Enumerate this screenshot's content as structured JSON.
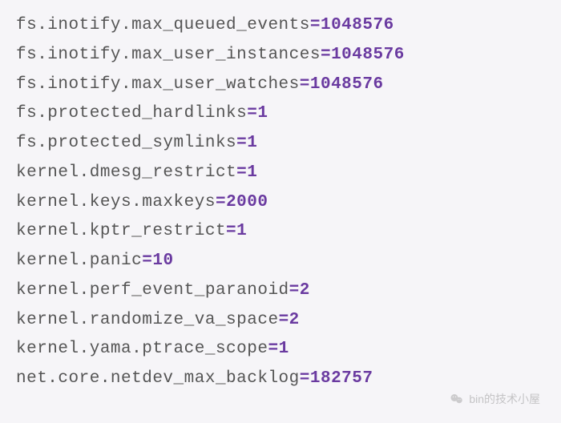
{
  "settings": [
    {
      "key": "fs.inotify.max_queued_events",
      "value": "1048576"
    },
    {
      "key": "fs.inotify.max_user_instances",
      "value": "1048576"
    },
    {
      "key": "fs.inotify.max_user_watches",
      "value": "1048576"
    },
    {
      "key": "fs.protected_hardlinks",
      "value": "1"
    },
    {
      "key": "fs.protected_symlinks",
      "value": "1"
    },
    {
      "key": "kernel.dmesg_restrict",
      "value": "1"
    },
    {
      "key": "kernel.keys.maxkeys",
      "value": "2000"
    },
    {
      "key": "kernel.kptr_restrict",
      "value": "1"
    },
    {
      "key": "kernel.panic",
      "value": "10"
    },
    {
      "key": "kernel.perf_event_paranoid",
      "value": "2"
    },
    {
      "key": "kernel.randomize_va_space",
      "value": "2"
    },
    {
      "key": "kernel.yama.ptrace_scope",
      "value": "1"
    },
    {
      "key": "net.core.netdev_max_backlog",
      "value": "182757"
    }
  ],
  "equals": "=",
  "watermark": {
    "text": "bin的技术小屋",
    "icon": "wechat-icon"
  }
}
